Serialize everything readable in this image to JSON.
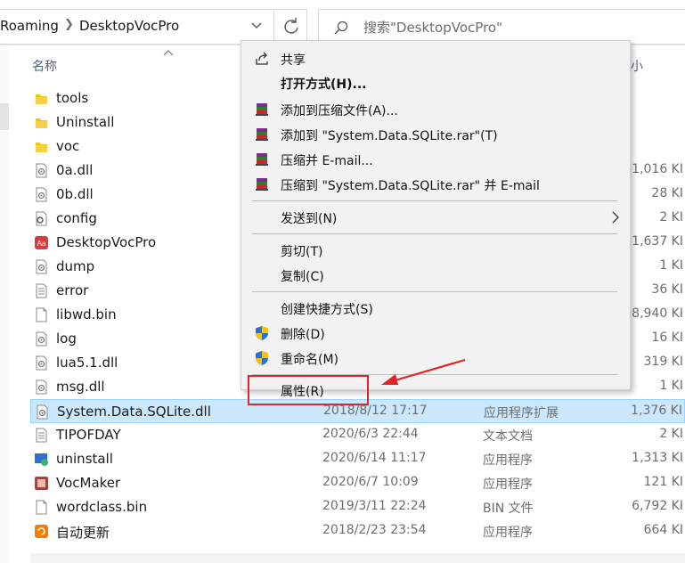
{
  "address_bar": {
    "segments": [
      "Roaming",
      "DesktopVocPro"
    ],
    "search_placeholder": "搜索\"DesktopVocPro\""
  },
  "file_list": {
    "header_name": "名称",
    "header_size_fragment": "小",
    "rows": [
      {
        "name": "tools",
        "date": "",
        "type": "",
        "size": "",
        "icon": "folder-icon"
      },
      {
        "name": "Uninstall",
        "date": "",
        "type": "",
        "size": "",
        "icon": "folder-icon"
      },
      {
        "name": "voc",
        "date": "",
        "type": "",
        "size": "",
        "icon": "folder-icon"
      },
      {
        "name": "0a.dll",
        "date": "",
        "type": "",
        "size": "1,016 KI",
        "icon": "dll-file-icon"
      },
      {
        "name": "0b.dll",
        "date": "",
        "type": "",
        "size": "28 KI",
        "icon": "dll-file-icon"
      },
      {
        "name": "config",
        "date": "",
        "type": "",
        "size": "2 KI",
        "icon": "config-file-icon"
      },
      {
        "name": "DesktopVocPro",
        "date": "",
        "type": "",
        "size": "1,637 KI",
        "icon": "app-icon"
      },
      {
        "name": "dump",
        "date": "",
        "type": "",
        "size": "1 KI",
        "icon": "dll-file-icon"
      },
      {
        "name": "error",
        "date": "",
        "type": "",
        "size": "36 KI",
        "icon": "text-file-icon"
      },
      {
        "name": "libwd.bin",
        "date": "",
        "type": "",
        "size": "98,940 KI",
        "icon": "blank-file-icon"
      },
      {
        "name": "log",
        "date": "",
        "type": "",
        "size": "16 KI",
        "icon": "dll-file-icon"
      },
      {
        "name": "lua5.1.dll",
        "date": "",
        "type": "",
        "size": "319 KI",
        "icon": "dll-file-icon"
      },
      {
        "name": "msg.dll",
        "date": "",
        "type": "",
        "size": "1 KI",
        "icon": "dll-file-icon"
      },
      {
        "name": "System.Data.SQLite.dll",
        "date": "2018/8/12 17:17",
        "type": "应用程序扩展",
        "size": "1,376 KI",
        "icon": "dll-file-icon",
        "selected": true
      },
      {
        "name": "TIPOFDAY",
        "date": "2020/6/3 22:44",
        "type": "文本文档",
        "size": "2 KI",
        "icon": "text-file-icon"
      },
      {
        "name": "uninstall",
        "date": "2020/6/14 11:17",
        "type": "应用程序",
        "size": "1,313 KI",
        "icon": "uninstall-app-icon"
      },
      {
        "name": "VocMaker",
        "date": "2020/6/7 10:09",
        "type": "应用程序",
        "size": "121 KI",
        "icon": "vocmaker-app-icon"
      },
      {
        "name": "wordclass.bin",
        "date": "2019/3/11 22:24",
        "type": "BIN 文件",
        "size": "6,792 KI",
        "icon": "blank-file-icon"
      },
      {
        "name": "自动更新",
        "date": "2018/2/23 23:54",
        "type": "应用程序",
        "size": "664 KI",
        "icon": "update-app-icon"
      }
    ]
  },
  "context_menu": {
    "items": [
      {
        "label": "共享",
        "icon": "share-icon"
      },
      {
        "label": "打开方式(H)...",
        "bold": true
      },
      {
        "label": "添加到压缩文件(A)...",
        "icon": "winrar-icon"
      },
      {
        "label": "添加到 \"System.Data.SQLite.rar\"(T)",
        "icon": "winrar-icon"
      },
      {
        "label": "压缩并 E-mail...",
        "icon": "winrar-icon"
      },
      {
        "label": "压缩到 \"System.Data.SQLite.rar\" 并 E-mail",
        "icon": "winrar-icon"
      },
      {
        "label": "发送到(N)",
        "submenu": true
      },
      {
        "label": "剪切(T)"
      },
      {
        "label": "复制(C)"
      },
      {
        "label": "创建快捷方式(S)"
      },
      {
        "label": "删除(D)",
        "icon": "uac-shield-icon"
      },
      {
        "label": "重命名(M)",
        "icon": "uac-shield-icon"
      },
      {
        "label": "属性(R)",
        "highlighted": true
      }
    ]
  },
  "colors": {
    "selection_bg": "#cce8ff",
    "selection_border": "#99d1ff",
    "annotation_red": "#e0242a",
    "menu_bg": "#f2f2f2",
    "header_text": "#4c607a"
  }
}
